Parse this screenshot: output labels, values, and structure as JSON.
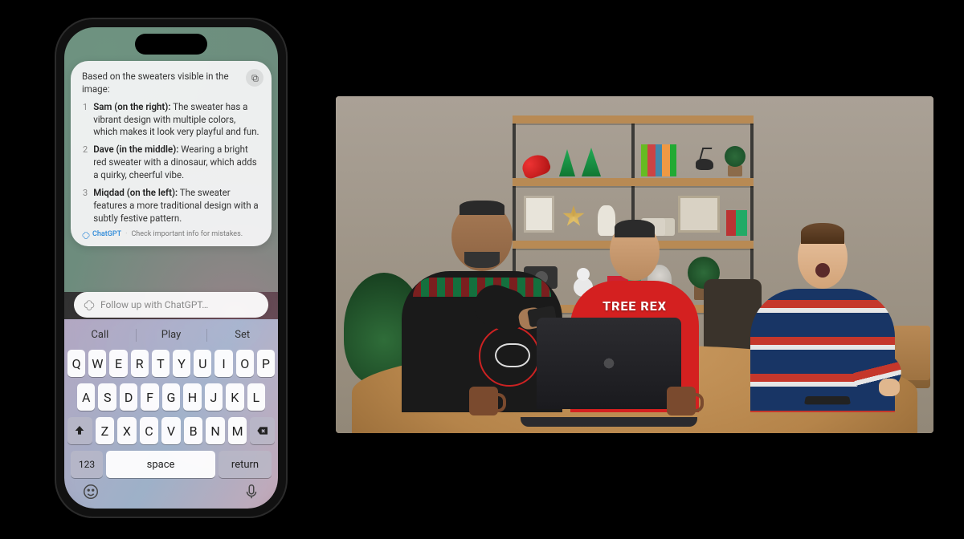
{
  "phone": {
    "response": {
      "intro": "Based on the sweaters visible in the image:",
      "items": [
        {
          "num": "1",
          "label": "Sam (on the right):",
          "text": "The sweater has a vibrant design with multiple colors, which makes it look very playful and fun."
        },
        {
          "num": "2",
          "label": "Dave (in the middle):",
          "text": "Wearing a bright red sweater with a dinosaur, which adds a quirky, cheerful vibe."
        },
        {
          "num": "3",
          "label": "Miqdad (on the left):",
          "text": "The sweater features a more traditional design with a subtly festive pattern."
        }
      ],
      "credit_brand": "ChatGPT",
      "credit_note": "Check important info for mistakes."
    },
    "input_placeholder": "Follow up with ChatGPT…",
    "keyboard": {
      "suggestions": [
        "Call",
        "Play",
        "Set"
      ],
      "row1": [
        "Q",
        "W",
        "E",
        "R",
        "T",
        "Y",
        "U",
        "I",
        "O",
        "P"
      ],
      "row2": [
        "A",
        "S",
        "D",
        "F",
        "G",
        "H",
        "J",
        "K",
        "L"
      ],
      "row3": [
        "Z",
        "X",
        "C",
        "V",
        "B",
        "N",
        "M"
      ],
      "numbers_key": "123",
      "space_key": "space",
      "return_key": "return"
    }
  },
  "video": {
    "sweater_text": "TREE REX"
  }
}
